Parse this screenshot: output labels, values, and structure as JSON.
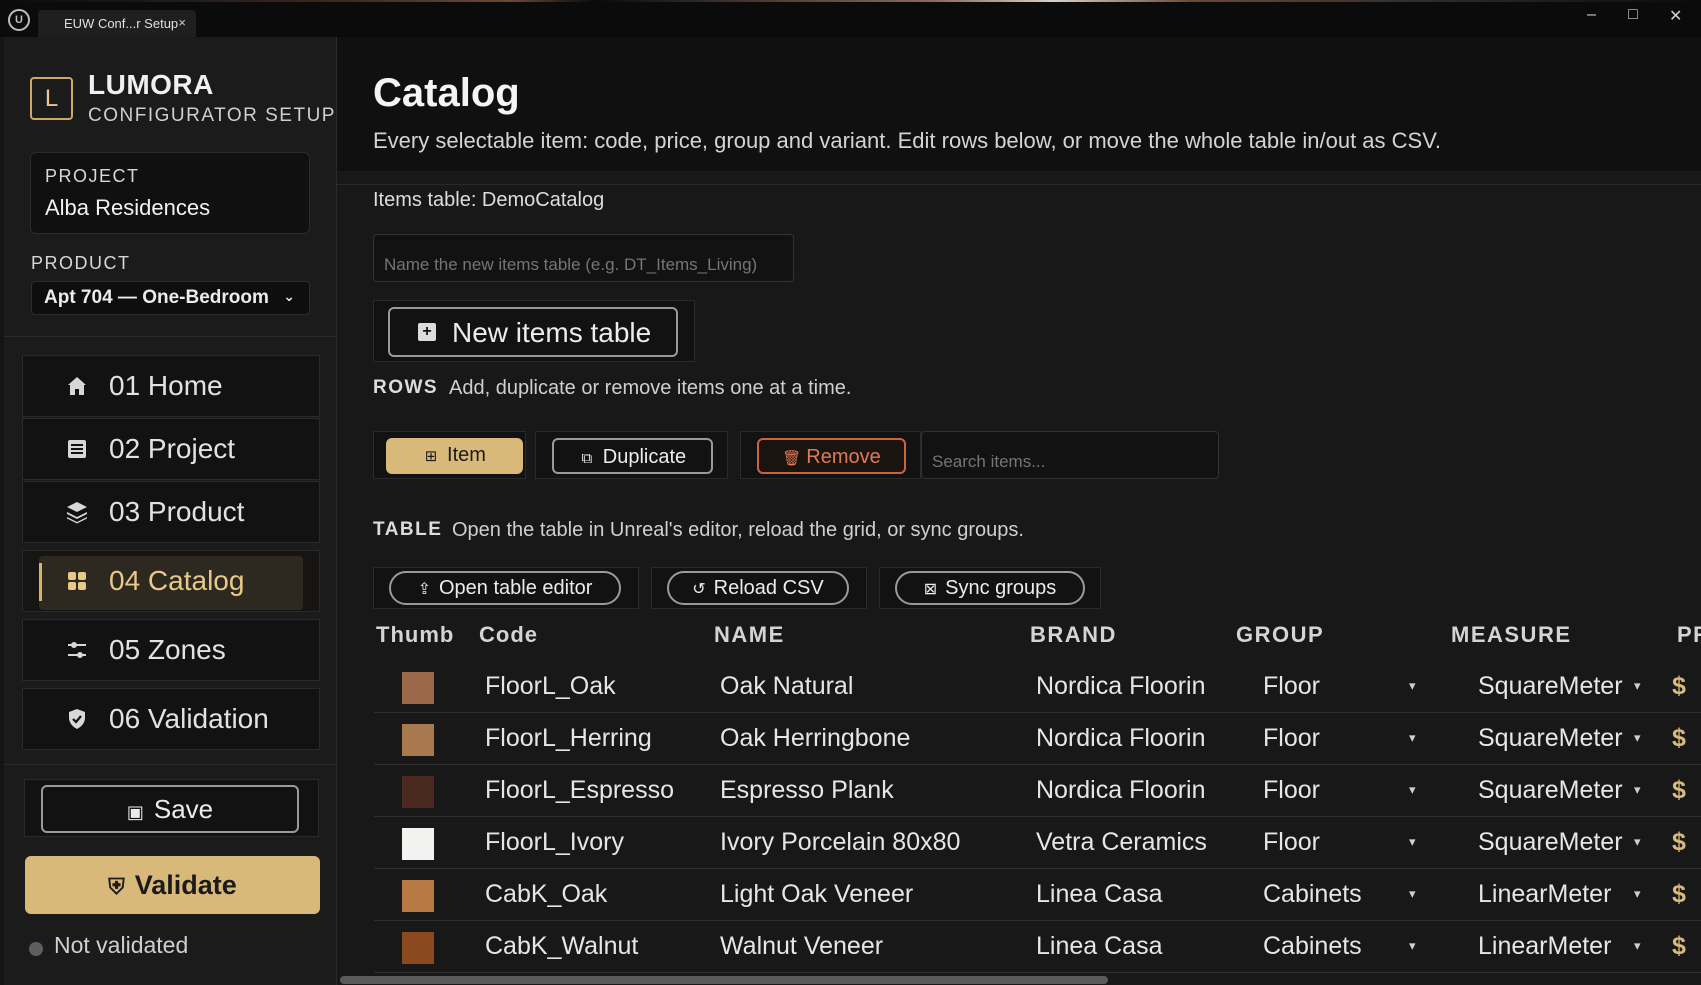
{
  "window": {
    "tab_title": "EUW Conf...r Setup",
    "tab_close": "×",
    "minimize": "–",
    "maximize": "□",
    "close": "✕"
  },
  "sidebar": {
    "brand_letter": "L",
    "brand_name": "LUMORA",
    "brand_sub": "CONFIGURATOR SETUP",
    "project_label": "PROJECT",
    "project_value": "Alba Residences",
    "product_label": "PRODUCT",
    "product_value": "Apt 704 — One-Bedroom",
    "nav": [
      {
        "label": "01 Home",
        "icon": "home-icon"
      },
      {
        "label": "02 Project",
        "icon": "list-icon"
      },
      {
        "label": "03 Product",
        "icon": "layers-icon"
      },
      {
        "label": "04 Catalog",
        "icon": "grid-icon",
        "active": true
      },
      {
        "label": "05 Zones",
        "icon": "sliders-icon"
      },
      {
        "label": "06 Validation",
        "icon": "shield-check-icon"
      }
    ],
    "save_label": "Save",
    "validate_label": "Validate",
    "status_text": "Not validated"
  },
  "main": {
    "title": "Catalog",
    "subtitle": "Every selectable item: code, price, group and variant. Edit rows below, or move the whole table in/out as CSV.",
    "items_table_label": "Items table: DemoCatalog",
    "name_placeholder": "Name the new items table (e.g. DT_Items_Living)",
    "new_table_label": "New items table",
    "rows_section": {
      "label": "ROWS",
      "desc": "Add, duplicate or remove items one at a time."
    },
    "item_button": "Item",
    "duplicate_button": "Duplicate",
    "remove_button": "Remove",
    "search_placeholder": "Search items...",
    "table_section": {
      "label": "TABLE",
      "desc": "Open the table in Unreal's editor, reload the grid, or sync groups."
    },
    "open_editor_button": "Open table editor",
    "reload_button": "Reload CSV",
    "sync_button": "Sync groups",
    "columns": [
      "Thumb",
      "Code",
      "NAME",
      "BRAND",
      "GROUP",
      "MEASURE",
      "PR"
    ],
    "rows": [
      {
        "code": "FloorL_Oak",
        "name": "Oak Natural",
        "brand": "Nordica Floorin",
        "group": "Floor",
        "measure": "SquareMeter",
        "price": "$",
        "thumb_color": "#9a6a48"
      },
      {
        "code": "FloorL_Herring",
        "name": "Oak Herringbone",
        "brand": "Nordica Floorin",
        "group": "Floor",
        "measure": "SquareMeter",
        "price": "$",
        "thumb_color": "#a8784f"
      },
      {
        "code": "FloorL_Espresso",
        "name": "Espresso Plank",
        "brand": "Nordica Floorin",
        "group": "Floor",
        "measure": "SquareMeter",
        "price": "$",
        "thumb_color": "#4a2a1e"
      },
      {
        "code": "FloorL_Ivory",
        "name": "Ivory Porcelain 80x80",
        "brand": "Vetra Ceramics",
        "group": "Floor",
        "measure": "SquareMeter",
        "price": "$",
        "thumb_color": "#f2f2f0"
      },
      {
        "code": "CabK_Oak",
        "name": "Light Oak Veneer",
        "brand": "Linea Casa",
        "group": "Cabinets",
        "measure": "LinearMeter",
        "price": "$",
        "thumb_color": "#b87a45"
      },
      {
        "code": "CabK_Walnut",
        "name": "Walnut Veneer",
        "brand": "Linea Casa",
        "group": "Cabinets",
        "measure": "LinearMeter",
        "price": "$",
        "thumb_color": "#8a4a1e"
      }
    ]
  }
}
